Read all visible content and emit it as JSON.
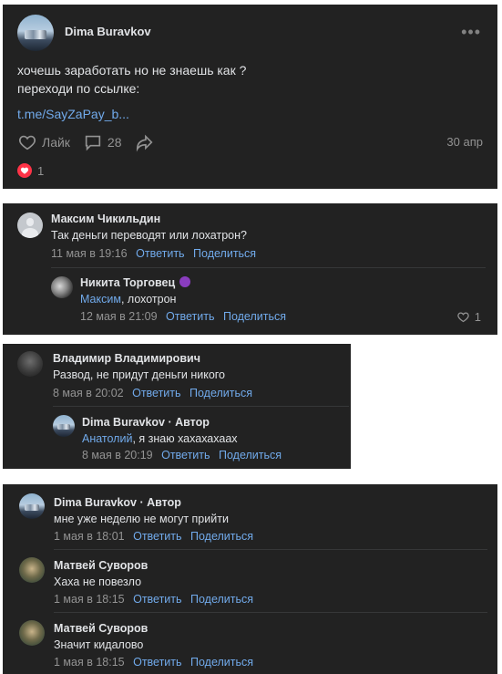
{
  "post": {
    "author": "Dima Buravkov",
    "more_icon": "more-dots-icon",
    "text_line1": "хочешь заработать но не знаешь как ?",
    "text_line2": "переходи по ссылке:",
    "link": "t.me/SayZaPay_b...",
    "like_label": "Лайк",
    "comments_count": "28",
    "date": "30 апр",
    "reactions_count": "1",
    "reaction_color": "#ff3347"
  },
  "comments": {
    "c1": {
      "author": "Максим Чикильдин",
      "text": "Так деньги переводят или лохатрон?",
      "date": "11 мая в 19:16",
      "reply_label": "Ответить",
      "share_label": "Поделиться",
      "reply": {
        "author": "Никита Торговец",
        "mention": "Максим",
        "text": ", лохотрон",
        "date": "12 мая в 21:09",
        "reply_label": "Ответить",
        "share_label": "Поделиться",
        "likes": "1"
      }
    },
    "c2": {
      "author": "Владимир Владимирович",
      "text": "Развод, не придут деньги никого",
      "date": "8 мая в 20:02",
      "reply_label": "Ответить",
      "share_label": "Поделиться",
      "reply": {
        "author": "Dima Buravkov · Автор",
        "mention": "Анатолий",
        "text": ", я знаю хахахахаах",
        "date": "8 мая в 20:19",
        "reply_label": "Ответить",
        "share_label": "Поделиться"
      }
    },
    "c3": {
      "items": [
        {
          "author": "Dima Buravkov · Автор",
          "text": "мне уже неделю не могут прийти",
          "date": "1 мая в 18:01",
          "reply_label": "Ответить",
          "share_label": "Поделиться"
        },
        {
          "author": "Матвей Суворов",
          "text": "Хаха не повезло",
          "date": "1 мая в 18:15",
          "reply_label": "Ответить",
          "share_label": "Поделиться"
        },
        {
          "author": "Матвей Суворов",
          "text": "Значит кидалово",
          "date": "1 мая в 18:15",
          "reply_label": "Ответить",
          "share_label": "Поделиться"
        }
      ]
    }
  },
  "colors": {
    "background": "#222222",
    "accent": "#71aaeb",
    "muted": "#939393",
    "text": "#e1e3e6"
  }
}
